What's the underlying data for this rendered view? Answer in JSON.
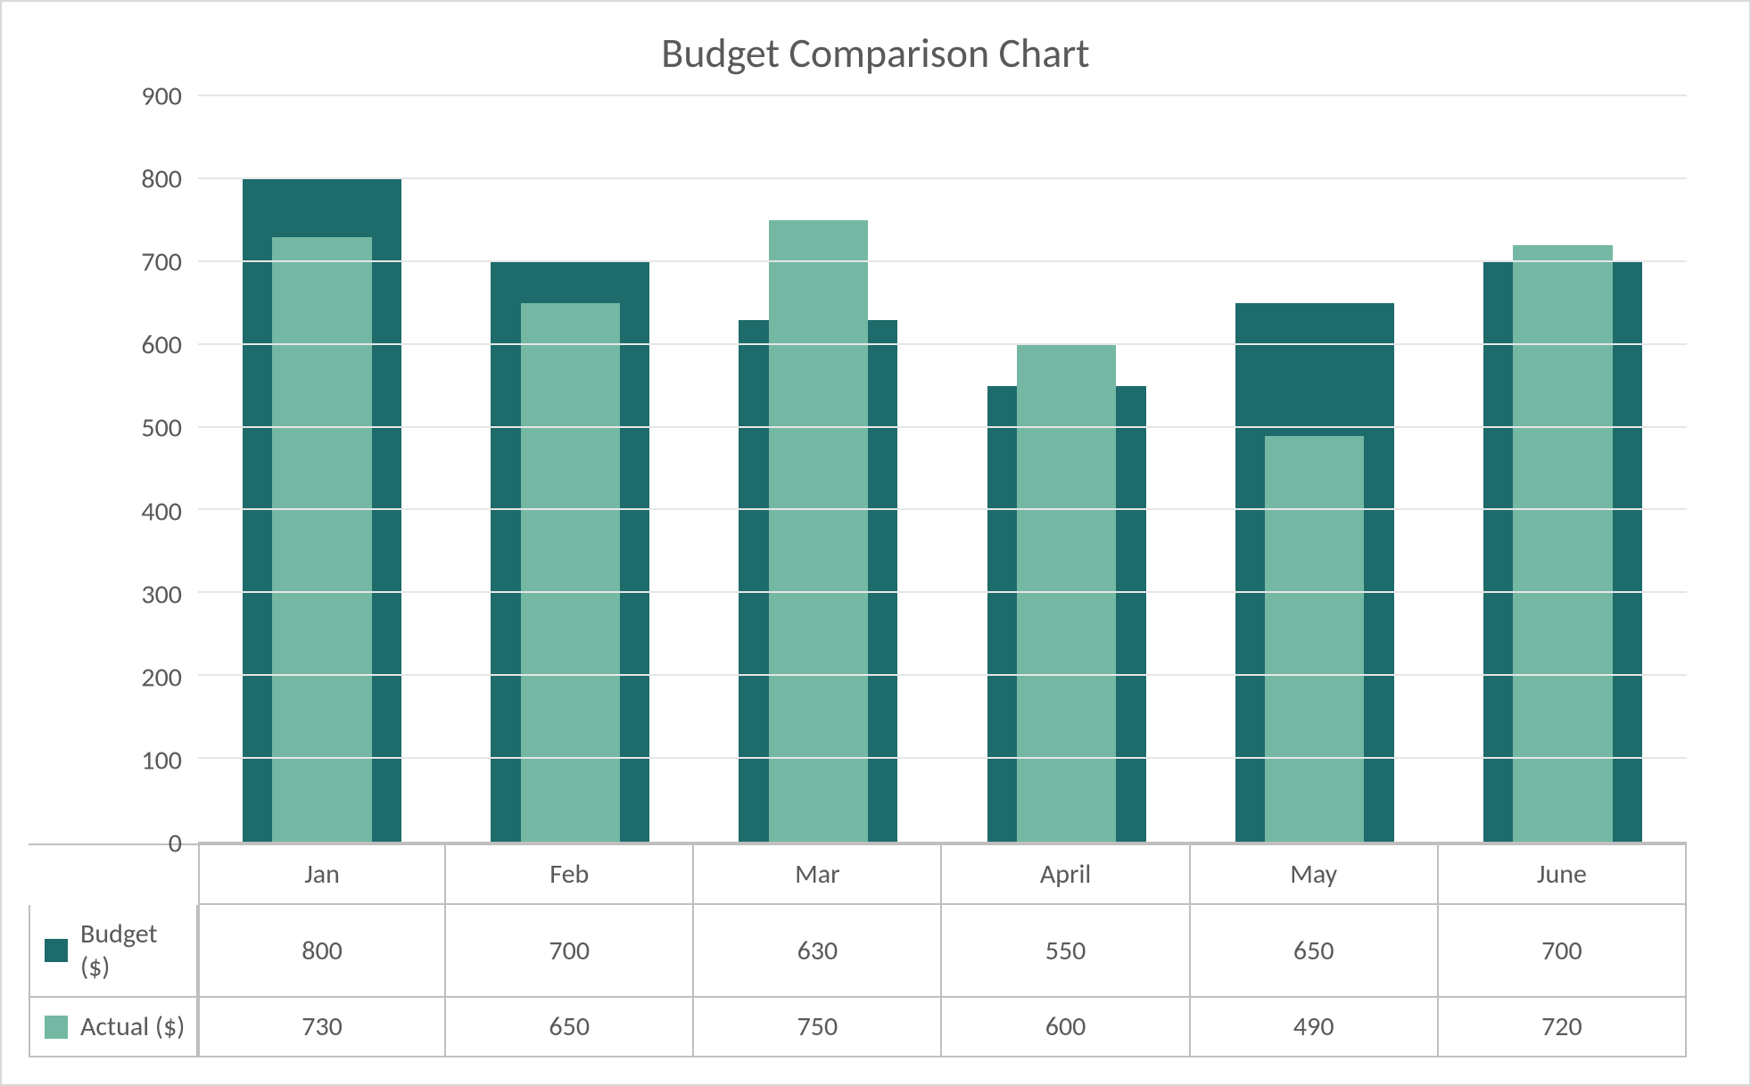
{
  "chart_data": {
    "type": "bar",
    "title": "Budget Comparison Chart",
    "categories": [
      "Jan",
      "Feb",
      "Mar",
      "April",
      "May",
      "June"
    ],
    "series": [
      {
        "name": "Budget ($)",
        "values": [
          800,
          700,
          630,
          550,
          650,
          700
        ],
        "color": "#1d6b6b"
      },
      {
        "name": "Actual ($)",
        "values": [
          730,
          650,
          750,
          600,
          490,
          720
        ],
        "color": "#74b8a4"
      }
    ],
    "xlabel": "",
    "ylabel": "",
    "ylim": [
      0,
      900
    ],
    "y_ticks": [
      0,
      100,
      200,
      300,
      400,
      500,
      600,
      700,
      800,
      900
    ],
    "grid": true,
    "legend_position": "bottom-table"
  }
}
